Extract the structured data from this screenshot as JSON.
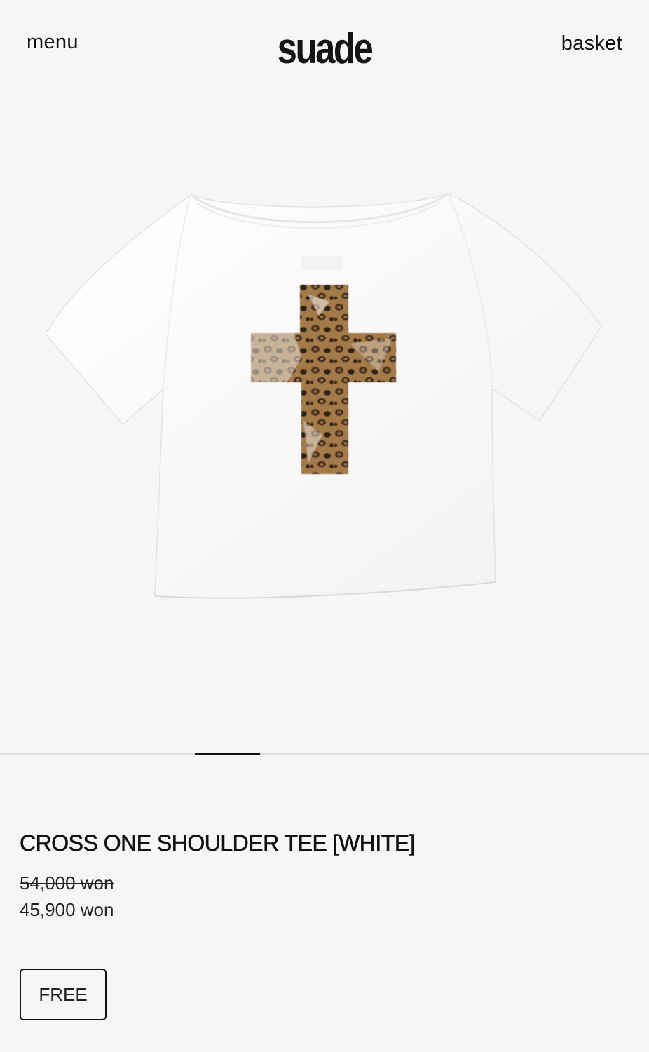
{
  "header": {
    "menu_label": "menu",
    "logo_text": "suade",
    "basket_label": "basket"
  },
  "product": {
    "image": {
      "shirt_color": "#ffffff",
      "print": "leopard-cross-print"
    },
    "gallery_indicator": {
      "current_slide": 4
    },
    "title": "CROSS ONE SHOULDER TEE [WHITE]",
    "price_original": "54,000 won",
    "price_sale": "45,900 won",
    "sizes": [
      {
        "label": "FREE"
      }
    ]
  },
  "colors": {
    "background": "#f6f6f6",
    "text": "#111111",
    "border": "#111111"
  }
}
